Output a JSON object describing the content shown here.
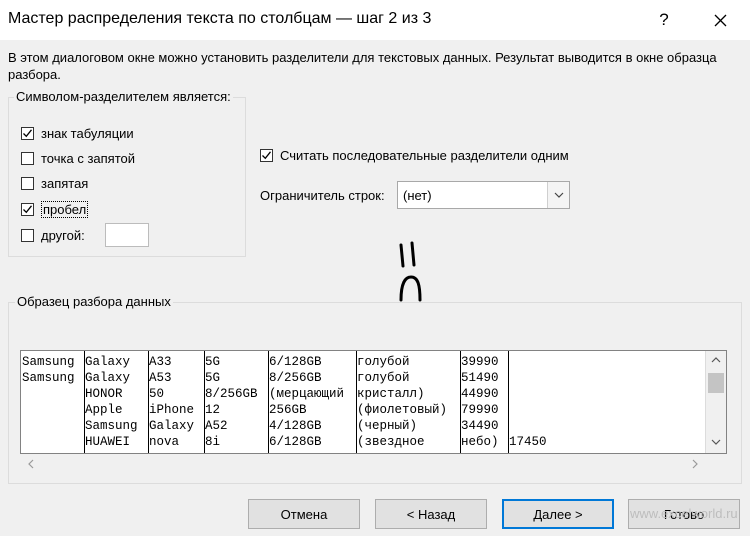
{
  "window": {
    "title": "Мастер распределения текста по столбцам — шаг 2 из 3",
    "help_label": "?",
    "close_label": "✕"
  },
  "description": "В этом диалоговом окне можно установить разделители для текстовых данных. Результат выводится в окне образца разбора.",
  "delimiters": {
    "legend": "Символом-разделителем является:",
    "tab": {
      "label": "знак табуляции",
      "checked": true
    },
    "semicolon": {
      "label": "точка с запятой",
      "checked": false
    },
    "comma": {
      "label": "запятая",
      "checked": false
    },
    "space": {
      "label": "пробел",
      "checked": true
    },
    "other": {
      "label": "другой:",
      "checked": false,
      "value": ""
    }
  },
  "consecutive": {
    "label": "Считать последовательные разделители одним",
    "checked": true
  },
  "text_qualifier": {
    "label": "Ограничитель строк:",
    "value": "(нет)"
  },
  "annotation": "II\n∩",
  "preview": {
    "legend": "Образец разбора данных",
    "rows": [
      [
        "Samsung",
        "Galaxy",
        "A33",
        "5G",
        "6/128GB",
        "голубой",
        "39990",
        ""
      ],
      [
        "Samsung",
        "Galaxy",
        "A53",
        "5G",
        "8/256GB",
        "голубой",
        "51490",
        ""
      ],
      [
        "",
        "HONOR",
        "50",
        "8/256GB",
        "(мерцающий",
        "кристалл)",
        "44990",
        ""
      ],
      [
        "",
        "Apple",
        "iPhone",
        "12",
        "256GB",
        "(фиолетовый)",
        "79990",
        ""
      ],
      [
        "",
        "Samsung",
        "Galaxy",
        "A52",
        "4/128GB",
        "(черный)",
        "34490",
        ""
      ],
      [
        "",
        "HUAWEI",
        "nova",
        "8i",
        "6/128GB",
        "(звездное",
        "небо)",
        "17450"
      ]
    ]
  },
  "buttons": {
    "cancel": "Отмена",
    "back": "< Назад",
    "next": "Далее >",
    "finish": "Готово"
  },
  "watermark": "www.excelworld.ru",
  "icons": {
    "help": "help-icon",
    "close": "close-icon",
    "check": "checkmark-icon",
    "dropdown": "chevron-down-icon",
    "scroll_up": "chevron-up-icon",
    "scroll_down": "chevron-down-icon",
    "scroll_left": "chevron-left-icon",
    "scroll_right": "chevron-right-icon"
  }
}
